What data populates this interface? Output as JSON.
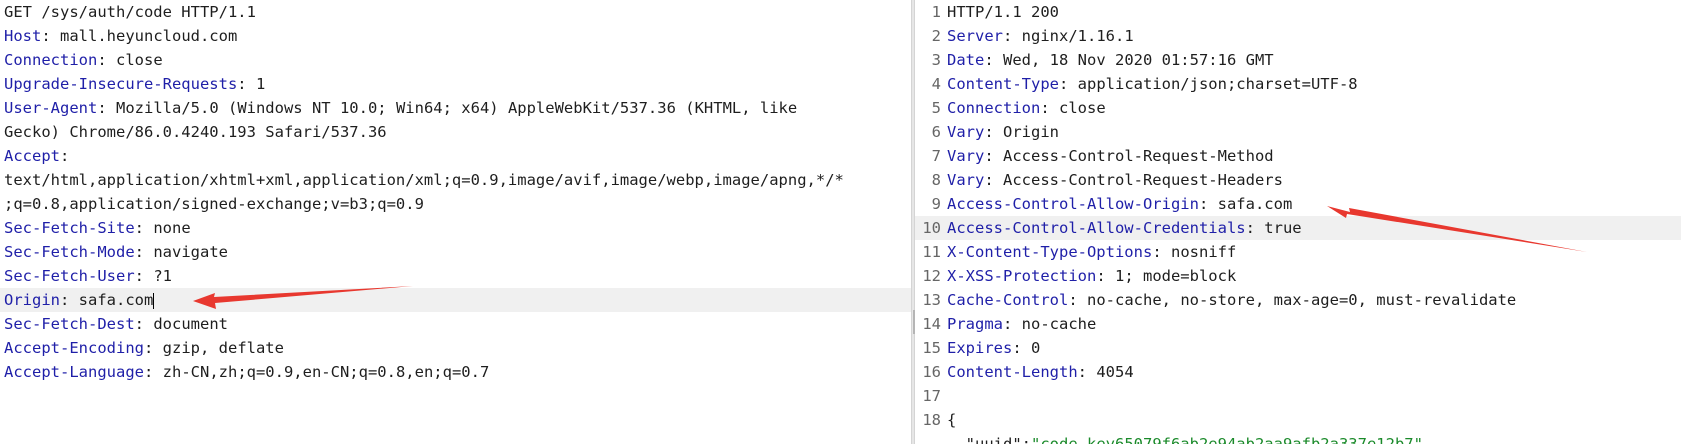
{
  "request": {
    "request_line": "GET /sys/auth/code HTTP/1.1",
    "lines": [
      {
        "key": "Host",
        "value": " mall.heyuncloud.com"
      },
      {
        "key": "Connection",
        "value": " close"
      },
      {
        "key": "Upgrade-Insecure-Requests",
        "value": " 1"
      },
      {
        "key": "User-Agent",
        "value": " Mozilla/5.0 (Windows NT 10.0; Win64; x64) AppleWebKit/537.36 (KHTML, like"
      },
      {
        "key": "",
        "value": "Gecko) Chrome/86.0.4240.193 Safari/537.36"
      },
      {
        "key": "Accept",
        "value": ""
      },
      {
        "key": "",
        "value": "text/html,application/xhtml+xml,application/xml;q=0.9,image/avif,image/webp,image/apng,*/*"
      },
      {
        "key": "",
        "value": ";q=0.8,application/signed-exchange;v=b3;q=0.9"
      },
      {
        "key": "Sec-Fetch-Site",
        "value": " none"
      },
      {
        "key": "Sec-Fetch-Mode",
        "value": " navigate"
      },
      {
        "key": "Sec-Fetch-User",
        "value": " ?1"
      },
      {
        "key": "Origin",
        "value": " safa.com"
      },
      {
        "key": "Sec-Fetch-Dest",
        "value": " document"
      },
      {
        "key": "Accept-Encoding",
        "value": " gzip, deflate"
      },
      {
        "key": "Accept-Language",
        "value": " zh-CN,zh;q=0.9,en-CN;q=0.8,en;q=0.7"
      }
    ]
  },
  "response": {
    "line_numbers": [
      "1",
      "2",
      "3",
      "4",
      "5",
      "6",
      "7",
      "8",
      "9",
      "10",
      "11",
      "12",
      "13",
      "14",
      "15",
      "16",
      "17",
      "18"
    ],
    "status_line": "HTTP/1.1 200",
    "lines": [
      {
        "key": "Server",
        "value": " nginx/1.16.1"
      },
      {
        "key": "Date",
        "value": " Wed, 18 Nov 2020 01:57:16 GMT"
      },
      {
        "key": "Content-Type",
        "value": " application/json;charset=UTF-8"
      },
      {
        "key": "Connection",
        "value": " close"
      },
      {
        "key": "Vary",
        "value": " Origin"
      },
      {
        "key": "Vary",
        "value": " Access-Control-Request-Method"
      },
      {
        "key": "Vary",
        "value": " Access-Control-Request-Headers"
      },
      {
        "key": "Access-Control-Allow-Origin",
        "value": " safa.com"
      },
      {
        "key": "Access-Control-Allow-Credentials",
        "value": " true"
      },
      {
        "key": "X-Content-Type-Options",
        "value": " nosniff"
      },
      {
        "key": "X-XSS-Protection",
        "value": " 1; mode=block"
      },
      {
        "key": "Cache-Control",
        "value": " no-cache, no-store, max-age=0, must-revalidate"
      },
      {
        "key": "Pragma",
        "value": " no-cache"
      },
      {
        "key": "Expires",
        "value": " 0"
      },
      {
        "key": "Content-Length",
        "value": " 4054"
      }
    ],
    "blank_line": "",
    "body_open": "{",
    "body_partial_key": "  \"uuid\"",
    "body_partial_sep": ":",
    "body_partial_value": "\"code-key65079f6ab2e94ab2aa9afb2a337e12b7\""
  },
  "colors": {
    "header_key": "#1f1fa8",
    "text": "#1e1e1e",
    "json_string": "#1a8a2a",
    "highlight_row": "#f0f0f0",
    "annotation_arrow": "#e8382f"
  }
}
